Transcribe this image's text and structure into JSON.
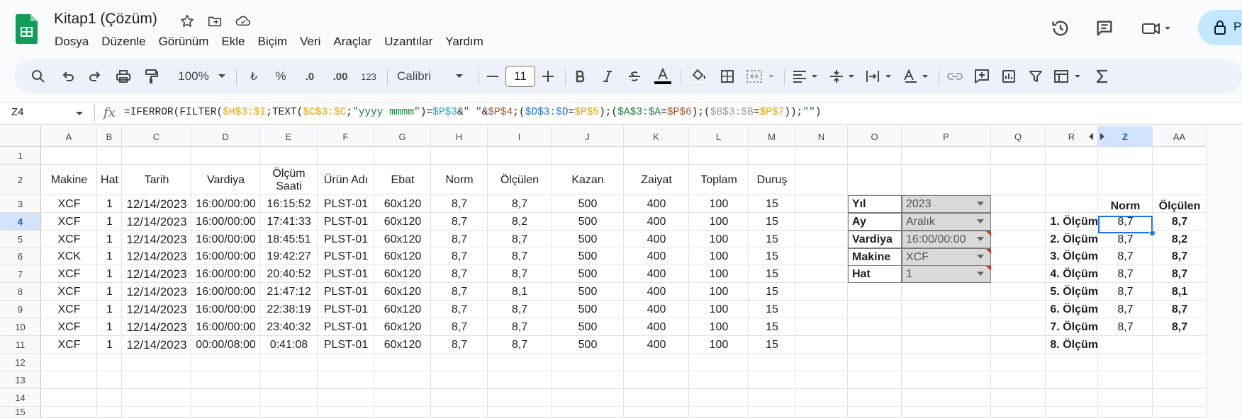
{
  "app": {
    "title": "Kitap1 (Çözüm)",
    "menu": [
      "Dosya",
      "Düzenle",
      "Görünüm",
      "Ekle",
      "Biçim",
      "Veri",
      "Araçlar",
      "Uzantılar",
      "Yardım"
    ],
    "share_initial": "P"
  },
  "toolbar": {
    "zoom": "100%",
    "currency": "₺",
    "percent": "%",
    "dec_less": ".0",
    "dec_more": ".00",
    "format_123": "123",
    "font": "Calibri",
    "font_size": "11"
  },
  "formula_bar": {
    "name_box": "Z4",
    "fx": "fx",
    "formula_parts": [
      {
        "t": "=IFERROR(FILTER(",
        "c": "#1f1f1f"
      },
      {
        "t": "$H$3:$I",
        "c": "#e8a202"
      },
      {
        "t": ";TEXT(",
        "c": "#1f1f1f"
      },
      {
        "t": "$C$3:$C",
        "c": "#e8a202"
      },
      {
        "t": ";",
        "c": "#1f1f1f"
      },
      {
        "t": "\"yyyy mmmm\"",
        "c": "#188038"
      },
      {
        "t": ")=",
        "c": "#1f1f1f"
      },
      {
        "t": "$P$3",
        "c": "#11a9cc"
      },
      {
        "t": "&",
        "c": "#1f1f1f"
      },
      {
        "t": "\" \"",
        "c": "#188038"
      },
      {
        "t": "&",
        "c": "#1f1f1f"
      },
      {
        "t": "$P$4",
        "c": "#a0522d"
      },
      {
        "t": ";(",
        "c": "#1f1f1f"
      },
      {
        "t": "$D$3:$D",
        "c": "#1a73e8"
      },
      {
        "t": "=",
        "c": "#1f1f1f"
      },
      {
        "t": "$P$5",
        "c": "#e8a202"
      },
      {
        "t": ");(",
        "c": "#1f1f1f"
      },
      {
        "t": "$A$3:$A",
        "c": "#188038"
      },
      {
        "t": "=",
        "c": "#1f1f1f"
      },
      {
        "t": "$P$6",
        "c": "#a0522d"
      },
      {
        "t": ");(",
        "c": "#1f1f1f"
      },
      {
        "t": "$B$3:$B",
        "c": "#999999"
      },
      {
        "t": "=",
        "c": "#1f1f1f"
      },
      {
        "t": "$P$7",
        "c": "#e8a202"
      },
      {
        "t": "));",
        "c": "#1f1f1f"
      },
      {
        "t": "\"\"",
        "c": "#188038"
      },
      {
        "t": ")",
        "c": "#1f1f1f"
      }
    ]
  },
  "columns": [
    "A",
    "B",
    "C",
    "D",
    "E",
    "F",
    "G",
    "H",
    "I",
    "J",
    "K",
    "L",
    "M",
    "N",
    "O",
    "P",
    "Q",
    "R",
    "Z",
    "AA"
  ],
  "rows": [
    "1",
    "2",
    "3",
    "4",
    "5",
    "6",
    "7",
    "8",
    "9",
    "10",
    "11",
    "12",
    "13",
    "14",
    "15"
  ],
  "selected": {
    "column": "Z",
    "row": "4"
  },
  "table": {
    "headers": [
      "Makine",
      "Hat",
      "Tarih",
      "Vardiya",
      "Ölçüm\nSaati",
      "Ürün Adı",
      "Ebat",
      "Norm",
      "Ölçülen",
      "Kazan",
      "Zaiyat",
      "Toplam",
      "Duruş"
    ],
    "rows": [
      [
        "XCF",
        "1",
        "12/14/2023",
        "16:00/00:00",
        "16:15:52",
        "PLST-01",
        "60x120",
        "8,7",
        "8,7",
        "500",
        "400",
        "100",
        "15"
      ],
      [
        "XCF",
        "1",
        "12/14/2023",
        "16:00/00:00",
        "17:41:33",
        "PLST-01",
        "60x120",
        "8,7",
        "8,2",
        "500",
        "400",
        "100",
        "15"
      ],
      [
        "XCF",
        "1",
        "12/14/2023",
        "16:00/00:00",
        "18:45:51",
        "PLST-01",
        "60x120",
        "8,7",
        "8,7",
        "500",
        "400",
        "100",
        "15"
      ],
      [
        "XCK",
        "1",
        "12/14/2023",
        "16:00/00:00",
        "19:42:27",
        "PLST-01",
        "60x120",
        "8,7",
        "8,7",
        "500",
        "400",
        "100",
        "15"
      ],
      [
        "XCF",
        "1",
        "12/14/2023",
        "16:00/00:00",
        "20:40:52",
        "PLST-01",
        "60x120",
        "8,7",
        "8,7",
        "500",
        "400",
        "100",
        "15"
      ],
      [
        "XCF",
        "1",
        "12/14/2023",
        "16:00/00:00",
        "21:47:12",
        "PLST-01",
        "60x120",
        "8,7",
        "8,1",
        "500",
        "400",
        "100",
        "15"
      ],
      [
        "XCF",
        "1",
        "12/14/2023",
        "16:00/00:00",
        "22:38:19",
        "PLST-01",
        "60x120",
        "8,7",
        "8,7",
        "500",
        "400",
        "100",
        "15"
      ],
      [
        "XCF",
        "1",
        "12/14/2023",
        "16:00/00:00",
        "23:40:32",
        "PLST-01",
        "60x120",
        "8,7",
        "8,7",
        "500",
        "400",
        "100",
        "15"
      ],
      [
        "XCF",
        "1",
        "12/14/2023",
        "00:00/08:00",
        "0:41:08",
        "PLST-01",
        "60x120",
        "8,7",
        "8,7",
        "500",
        "400",
        "100",
        "15"
      ]
    ]
  },
  "filters": [
    {
      "label": "Yıl",
      "value": "2023",
      "note": false
    },
    {
      "label": "Ay",
      "value": "Aralık",
      "note": false
    },
    {
      "label": "Vardiya",
      "value": "16:00/00:00",
      "note": true
    },
    {
      "label": "Makine",
      "value": "XCF",
      "note": true
    },
    {
      "label": "Hat",
      "value": "1",
      "note": true
    }
  ],
  "results": {
    "headers": [
      "Norm",
      "Ölçülen"
    ],
    "rows": [
      {
        "label": "1. Ölçüm",
        "norm": "8,7",
        "olculen": "8,7"
      },
      {
        "label": "2. Ölçüm",
        "norm": "8,7",
        "olculen": "8,2"
      },
      {
        "label": "3. Ölçüm",
        "norm": "8,7",
        "olculen": "8,7"
      },
      {
        "label": "4. Ölçüm",
        "norm": "8,7",
        "olculen": "8,7"
      },
      {
        "label": "5. Ölçüm",
        "norm": "8,7",
        "olculen": "8,1"
      },
      {
        "label": "6. Ölçüm",
        "norm": "8,7",
        "olculen": "8,7"
      },
      {
        "label": "7. Ölçüm",
        "norm": "8,7",
        "olculen": "8,7"
      },
      {
        "label": "8. Ölçüm",
        "norm": "",
        "olculen": ""
      }
    ]
  },
  "colors": {
    "accent": "#1a73e8",
    "selection": "#d3e3fd",
    "sheets_green": "#0f9d58"
  }
}
